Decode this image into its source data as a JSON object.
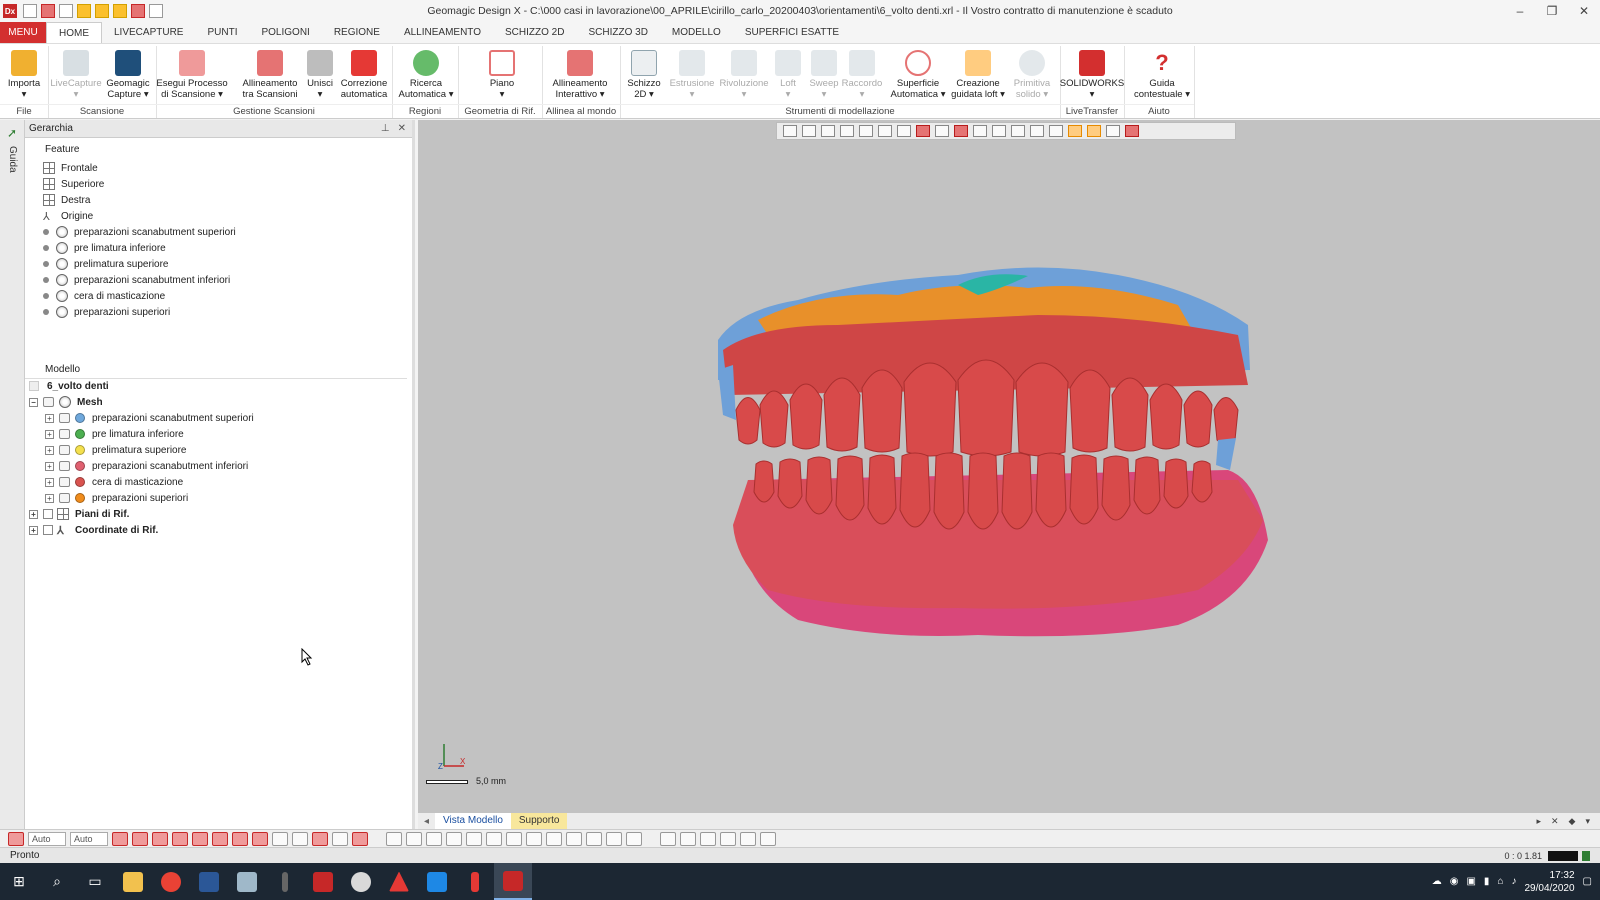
{
  "window": {
    "title": "Geomagic Design X - C:\\000 casi in lavorazione\\00_APRILE\\cirillo_carlo_20200403\\orientamenti\\6_volto denti.xrl - Il Vostro contratto di manutenzione è scaduto",
    "app_icon": "Dx"
  },
  "tabs": [
    "MENU",
    "HOME",
    "LIVECAPTURE",
    "PUNTI",
    "POLIGONI",
    "REGIONE",
    "ALLINEAMENTO",
    "SCHIZZO 2D",
    "SCHIZZO 3D",
    "MODELLO",
    "SUPERFICI ESATTE"
  ],
  "ribbon": {
    "buttons": [
      {
        "l1": "Importa",
        "l2": "▾"
      },
      {
        "l1": "LiveCapture",
        "l2": "▾"
      },
      {
        "l1": "Geomagic",
        "l2": "Capture ▾"
      },
      {
        "l1": "Esegui Processo",
        "l2": "di Scansione ▾"
      },
      {
        "l1": "Allineamento",
        "l2": "tra Scansioni"
      },
      {
        "l1": "Unisci",
        "l2": "▾"
      },
      {
        "l1": "Correzione",
        "l2": "automatica"
      },
      {
        "l1": "Ricerca",
        "l2": "Automatica ▾"
      },
      {
        "l1": "Piano",
        "l2": "▾"
      },
      {
        "l1": "Allineamento",
        "l2": "Interattivo ▾"
      },
      {
        "l1": "Schizzo",
        "l2": "2D ▾"
      },
      {
        "l1": "Estrusione",
        "l2": "▾"
      },
      {
        "l1": "Rivoluzione",
        "l2": "▾"
      },
      {
        "l1": "Loft",
        "l2": "▾"
      },
      {
        "l1": "Sweep",
        "l2": "▾"
      },
      {
        "l1": "Raccordo",
        "l2": "▾"
      },
      {
        "l1": "Superficie",
        "l2": "Automatica ▾"
      },
      {
        "l1": "Creazione",
        "l2": "guidata loft ▾"
      },
      {
        "l1": "Primitiva",
        "l2": "solido ▾"
      },
      {
        "l1": "SOLIDWORKS",
        "l2": "▾"
      },
      {
        "l1": "Guida",
        "l2": "contestuale ▾"
      }
    ],
    "groups": [
      "File",
      "Scansione",
      "Gestione Scansioni",
      "Regioni",
      "Geometria di Rif.",
      "Allinea al mondo",
      "Strumenti di modellazione",
      "LiveTransfer",
      "Aiuto"
    ]
  },
  "sidestrip": {
    "label": "Guida"
  },
  "panel": {
    "title": "Gerarchia",
    "feature_header": "Feature",
    "features": [
      "Frontale",
      "Superiore",
      "Destra",
      "Origine"
    ],
    "feature_meshes": [
      "preparazioni scanabutment superiori",
      "pre limatura inferiore",
      "prelimatura superiore",
      "preparazioni scanabutment inferiori",
      "cera di masticazione",
      "preparazioni superiori"
    ],
    "model_header": "Modello",
    "model_root": "6_volto denti",
    "mesh_group": "Mesh",
    "meshes": [
      {
        "name": "preparazioni scanabutment superiori",
        "color": "#6fa8dc"
      },
      {
        "name": "pre limatura inferiore",
        "color": "#4caf50"
      },
      {
        "name": "prelimatura superiore",
        "color": "#f4e04d"
      },
      {
        "name": "preparazioni scanabutment inferiori",
        "color": "#e06070"
      },
      {
        "name": "cera di masticazione",
        "color": "#d9534f"
      },
      {
        "name": "preparazioni superiori",
        "color": "#f08c1c"
      }
    ],
    "ref_planes": "Piani di Rif.",
    "ref_coords": "Coordinate di Rif."
  },
  "viewport": {
    "scale_label": "5,0 mm",
    "axis_x": "X",
    "axis_z": "Z",
    "model_colors": {
      "teeth": "#d84a4a",
      "gum_lower": "#d9477a",
      "blue": "#6ea0d8",
      "orange": "#e8902a",
      "teal": "#2ab5a5"
    }
  },
  "view_tabs": [
    "Vista Modello",
    "Supporto"
  ],
  "bottombar": {
    "combo1": "Auto",
    "combo2": "Auto"
  },
  "status": {
    "text": "Pronto",
    "zoom": "0 : 0  1.81"
  },
  "taskbar": {
    "time": "17:32",
    "date": "29/04/2020"
  }
}
